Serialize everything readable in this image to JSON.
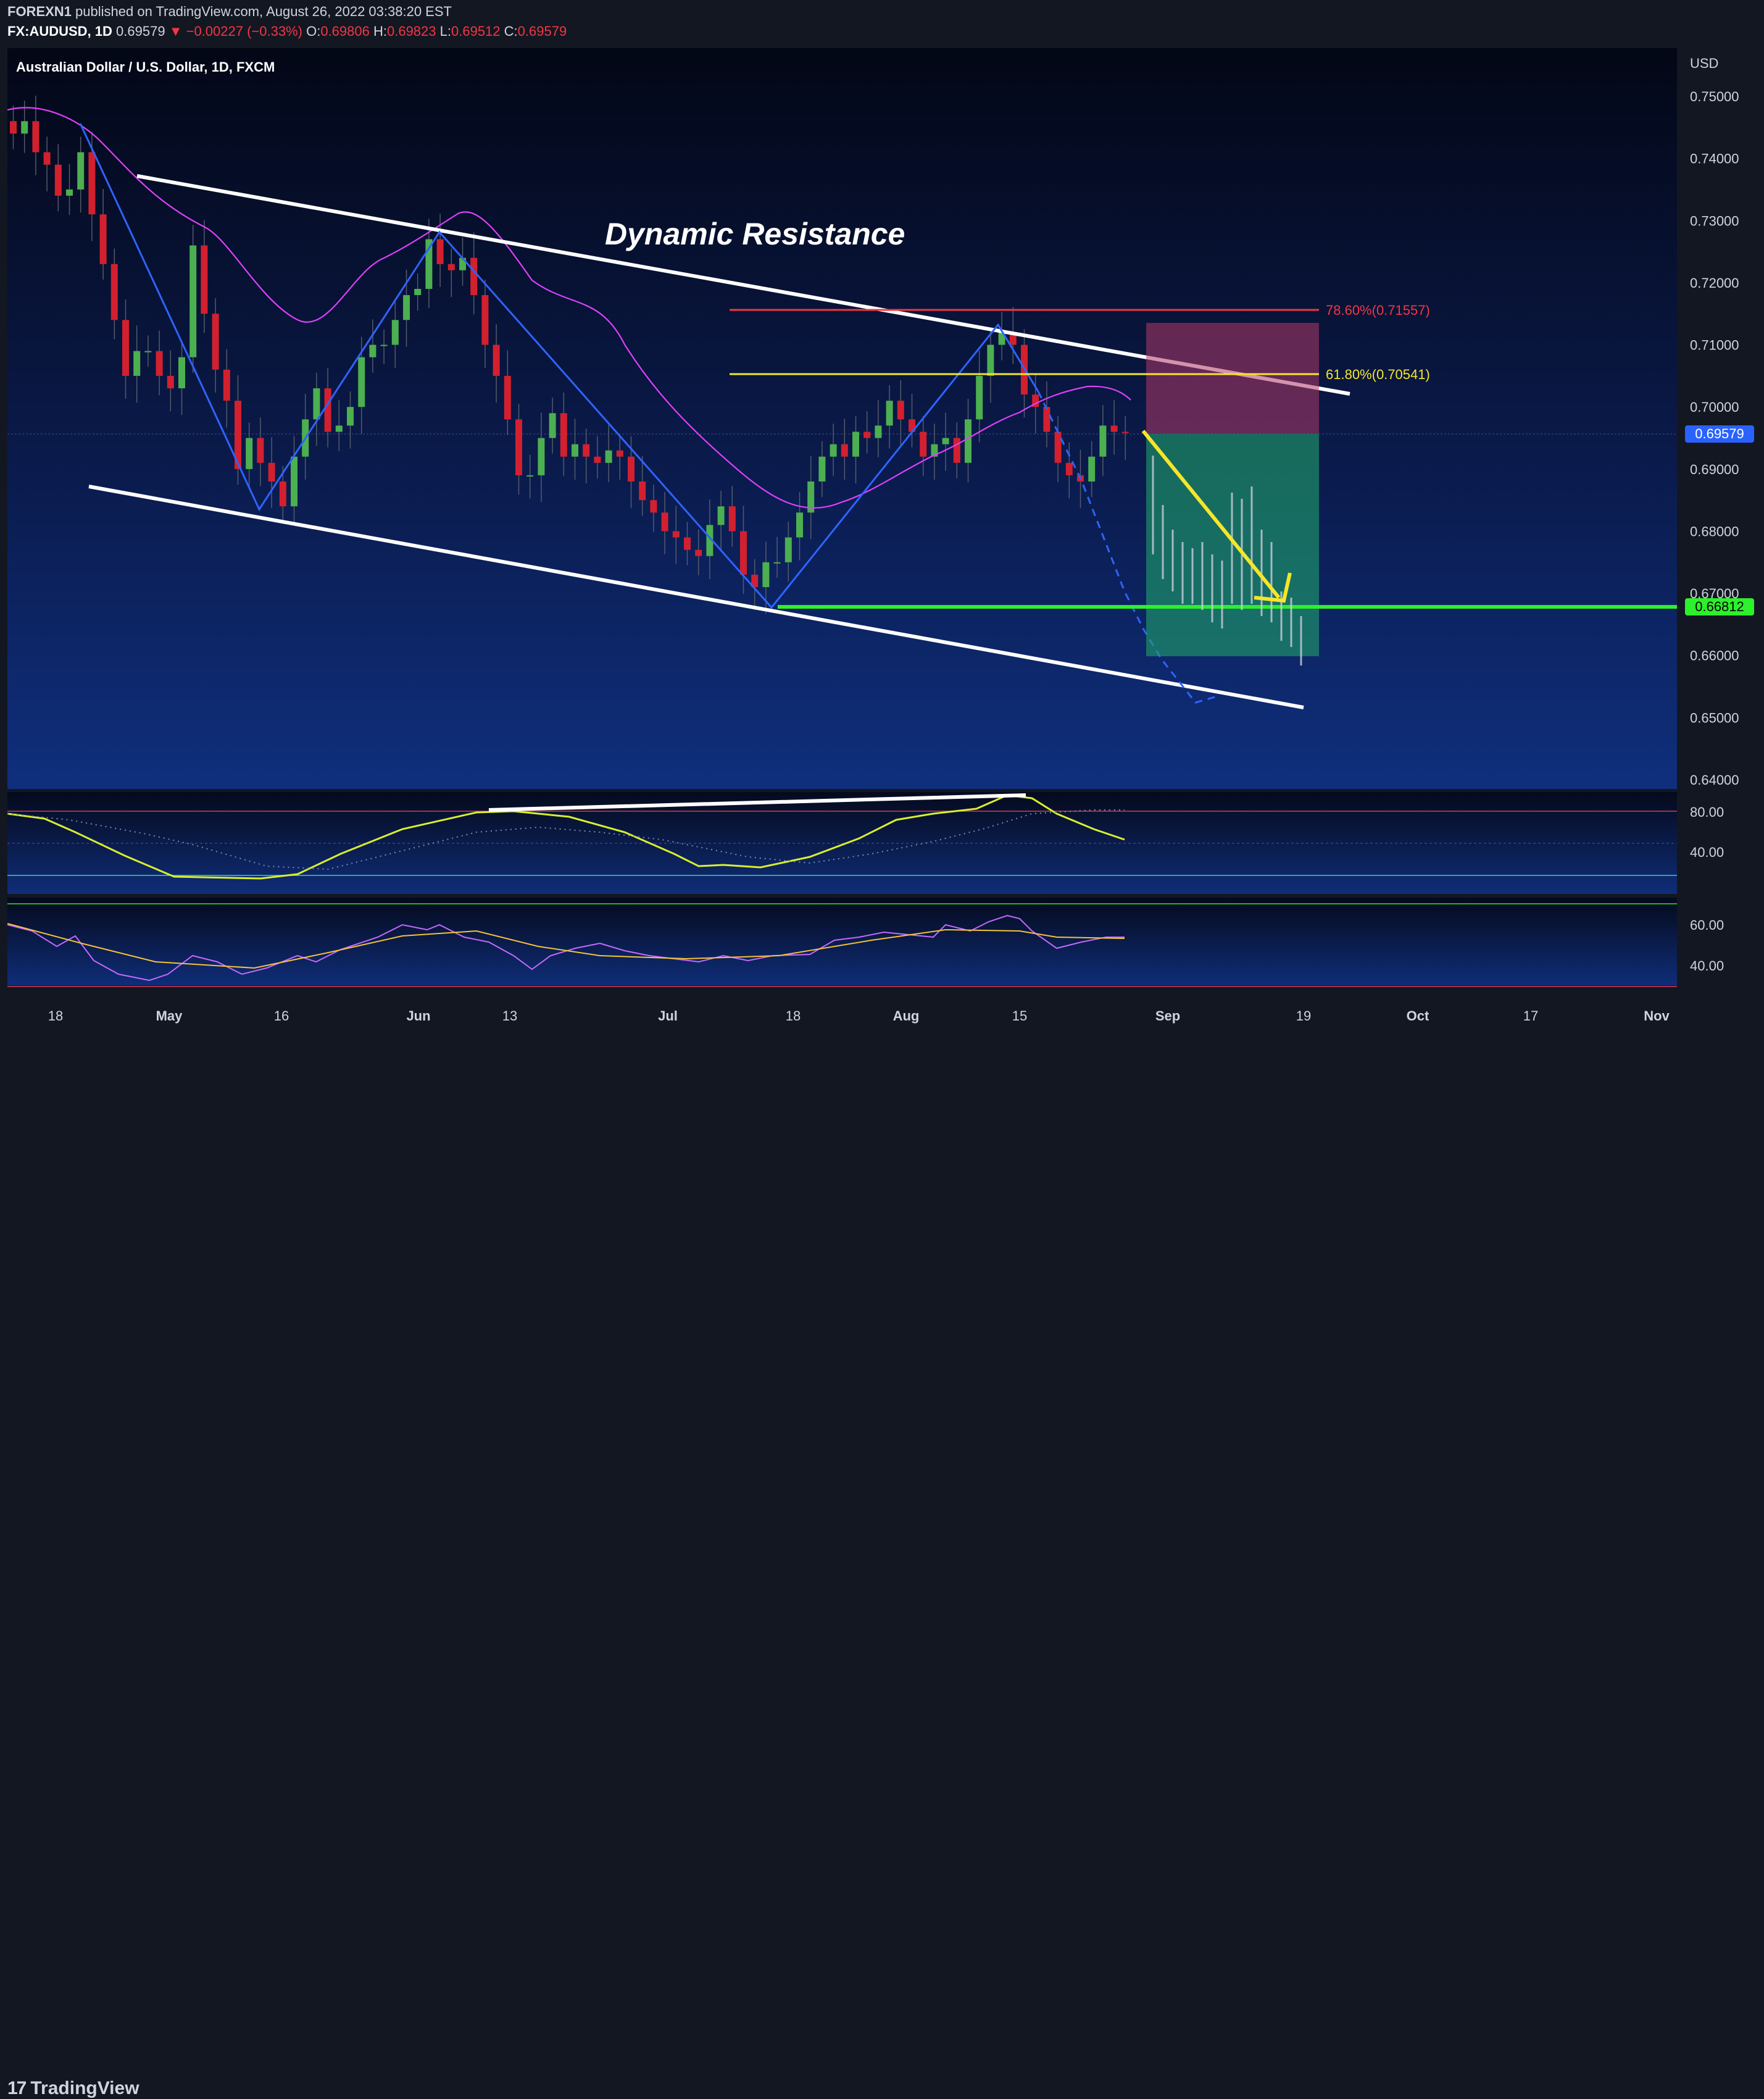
{
  "header": {
    "publisher": "FOREXN1",
    "published_text": "published on TradingView.com, August 26, 2022 03:38:20 EST",
    "symbol": "FX:AUDUSD, 1D",
    "last": "0.69579",
    "change_arrow": "▼",
    "change": "−0.00227 (−0.33%)",
    "o_label": "O:",
    "o": "0.69806",
    "h_label": "H:",
    "h": "0.69823",
    "l_label": "L:",
    "l": "0.69512",
    "c_label": "C:",
    "c": "0.69579"
  },
  "chart": {
    "instrument_title": "Australian Dollar / U.S. Dollar, 1D, FXCM",
    "currency": "USD",
    "annotation_text": "Dynamic Resistance",
    "fib_786_label": "78.60%(0.71557)",
    "fib_618_label": "61.80%(0.70541)",
    "price_badge": "0.69579",
    "target_badge": "0.66812"
  },
  "chart_data": {
    "type": "candlestick",
    "timeframe": "1D",
    "price_axis": {
      "ticks": [
        "0.75000",
        "0.74000",
        "0.73000",
        "0.72000",
        "0.71000",
        "0.70000",
        "0.69000",
        "0.68000",
        "0.67000",
        "0.66000",
        "0.65000",
        "0.64000"
      ],
      "ylim": [
        0.637,
        0.748
      ]
    },
    "time_axis": {
      "ticks": [
        "18",
        "May",
        "16",
        "Jun",
        "13",
        "Jul",
        "18",
        "Aug",
        "15",
        "Sep",
        "19",
        "Oct",
        "17",
        "Nov"
      ]
    },
    "levels": [
      {
        "name": "fib 78.6%",
        "value": 0.71557,
        "color": "#f23645"
      },
      {
        "name": "fib 61.8%",
        "value": 0.70541,
        "color": "#f5e629"
      },
      {
        "name": "target",
        "value": 0.66812,
        "color": "#2cf02c"
      }
    ],
    "current_price": 0.69579,
    "candles_close": [
      0.744,
      0.746,
      0.741,
      0.739,
      0.734,
      0.735,
      0.741,
      0.731,
      0.723,
      0.714,
      0.705,
      0.709,
      0.709,
      0.705,
      0.703,
      0.708,
      0.726,
      0.715,
      0.706,
      0.701,
      0.69,
      0.695,
      0.691,
      0.688,
      0.684,
      0.692,
      0.698,
      0.703,
      0.696,
      0.697,
      0.7,
      0.708,
      0.71,
      0.71,
      0.714,
      0.718,
      0.719,
      0.727,
      0.723,
      0.722,
      0.724,
      0.718,
      0.71,
      0.705,
      0.698,
      0.689,
      0.689,
      0.695,
      0.699,
      0.692,
      0.694,
      0.692,
      0.691,
      0.693,
      0.692,
      0.688,
      0.685,
      0.683,
      0.68,
      0.679,
      0.677,
      0.676,
      0.681,
      0.684,
      0.68,
      0.673,
      0.671,
      0.675,
      0.675,
      0.679,
      0.683,
      0.688,
      0.692,
      0.694,
      0.692,
      0.696,
      0.695,
      0.697,
      0.701,
      0.698,
      0.696,
      0.692,
      0.694,
      0.695,
      0.691,
      0.698,
      0.705,
      0.71,
      0.712,
      0.71,
      0.702,
      0.7,
      0.696,
      0.691,
      0.689,
      0.688,
      0.692,
      0.697,
      0.696,
      0.6958
    ]
  },
  "indicators": {
    "osc1_ticks": [
      "80.00",
      "40.00"
    ],
    "osc2_ticks": [
      "60.00",
      "40.00"
    ]
  },
  "footer": {
    "brand": "TradingView"
  }
}
